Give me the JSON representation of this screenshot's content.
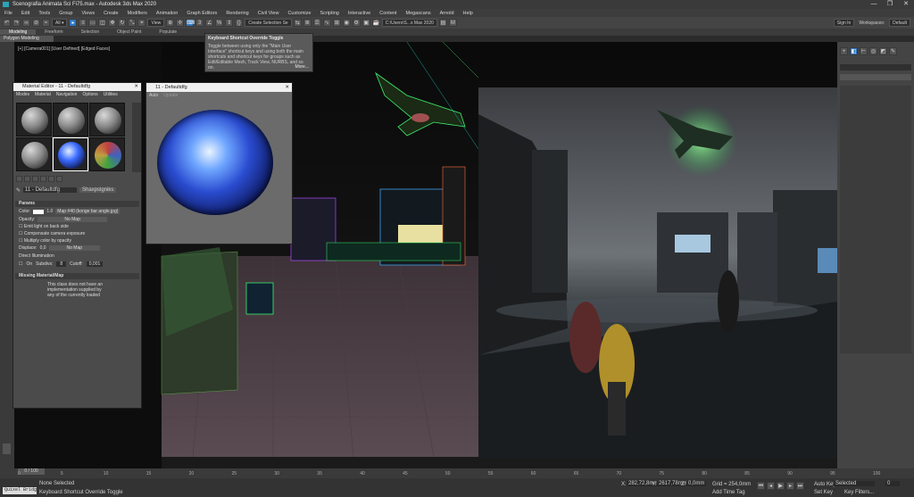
{
  "window": {
    "title": "Scenografia Animata Sci Fi75.max - Autodesk 3ds Max 2020",
    "controls": [
      "—",
      "❐",
      "✕"
    ]
  },
  "menubar": {
    "items": [
      "File",
      "Edit",
      "Tools",
      "Group",
      "Views",
      "Create",
      "Modifiers",
      "Animation",
      "Graph Editors",
      "Rendering",
      "Civil View",
      "Customize",
      "Scripting",
      "Interactive",
      "Content",
      "Megascans",
      "Arnold",
      "Help"
    ]
  },
  "toolbar": {
    "view_dropdown": "View",
    "selection_set": "Create Selection Se",
    "path": "C:\\Users\\S...s Max 2020",
    "sign_in": "Sign In",
    "workspaces_label": "Workspaces:",
    "workspace_value": "Default"
  },
  "ribbon": {
    "tabs": [
      "Modeling",
      "Freeform",
      "Selection",
      "Object Paint",
      "Populate"
    ],
    "active_tab": "Modeling",
    "sub_label": "Polygon Modeling"
  },
  "viewport": {
    "label": "[+] [Camera001] [User Defined] [Edged Faces]"
  },
  "tooltip": {
    "title": "Keyboard Shortcut Override Toggle",
    "body": "Toggle between using only the \"Main User Interface\" shortcut keys and using both the main shortcuts and shortcut keys for groups such as Edit/Editable Mesh, Track View, NURBS, and so on.",
    "more": "More..."
  },
  "material_editor": {
    "title": "Material Editor - 11 - Defaultdfg",
    "menu": [
      "Modes",
      "Material",
      "Navigation",
      "Options",
      "Utilities"
    ],
    "material_name": "11 - Defaultdfg",
    "material_type": "Shaxpslgniks",
    "params_header": "Params",
    "color_label": "Color:",
    "color_value": "1.0",
    "color_map": "Map #40 (konge bar angle.jpg)",
    "opacity_label": "Opacity:",
    "opacity_map": "No Map",
    "check1": "Emit light on back side",
    "check2": "Compensate camera exposure",
    "check3": "Multiply color by opacity",
    "displace_label": "Displace:",
    "displace_value": "0,0",
    "displace_map": "No Map",
    "direct_illum_label": "Direct Illumination",
    "on_label": "On",
    "subdivs_label": "Subdivs:",
    "subdivs_value": "8",
    "cutoff_label": "Cutoff:",
    "cutoff_value": "0,001",
    "missing_header": "Missing Material/Map",
    "missing_text": "This class does not have an implementation supplied by any of the currently loaded DLLs."
  },
  "preview": {
    "title": "11 - Defaultdfg",
    "auto_label": "Auto",
    "update_label": "Update"
  },
  "timeline": {
    "frame_counter": "0 / 100",
    "ticks": [
      "0",
      "5",
      "10",
      "15",
      "20",
      "25",
      "30",
      "35",
      "40",
      "45",
      "50",
      "55",
      "60",
      "65",
      "70",
      "75",
      "80",
      "85",
      "90",
      "95",
      "100"
    ]
  },
  "statusbar": {
    "script_label": "Quixel Bridg",
    "selection": "None Selected",
    "prompt": "Keyboard Shortcut Override Toggle",
    "x_label": "X:",
    "x_value": "282,72,8mm",
    "y_label": "Y:",
    "y_value": "2617,78mm",
    "z_label": "Z:",
    "z_value": "0,0mm",
    "grid": "Grid = 254,0mm",
    "add_time_tag": "Add Time Tag",
    "auto_key": "Auto Key",
    "set_key": "Set Key",
    "selected": "Selected",
    "key_filters": "Key Filters...",
    "frame": "0"
  },
  "colors": {
    "accent": "#2e78c2",
    "panel": "#444444",
    "viewport_bg": "#0d0d0d"
  }
}
